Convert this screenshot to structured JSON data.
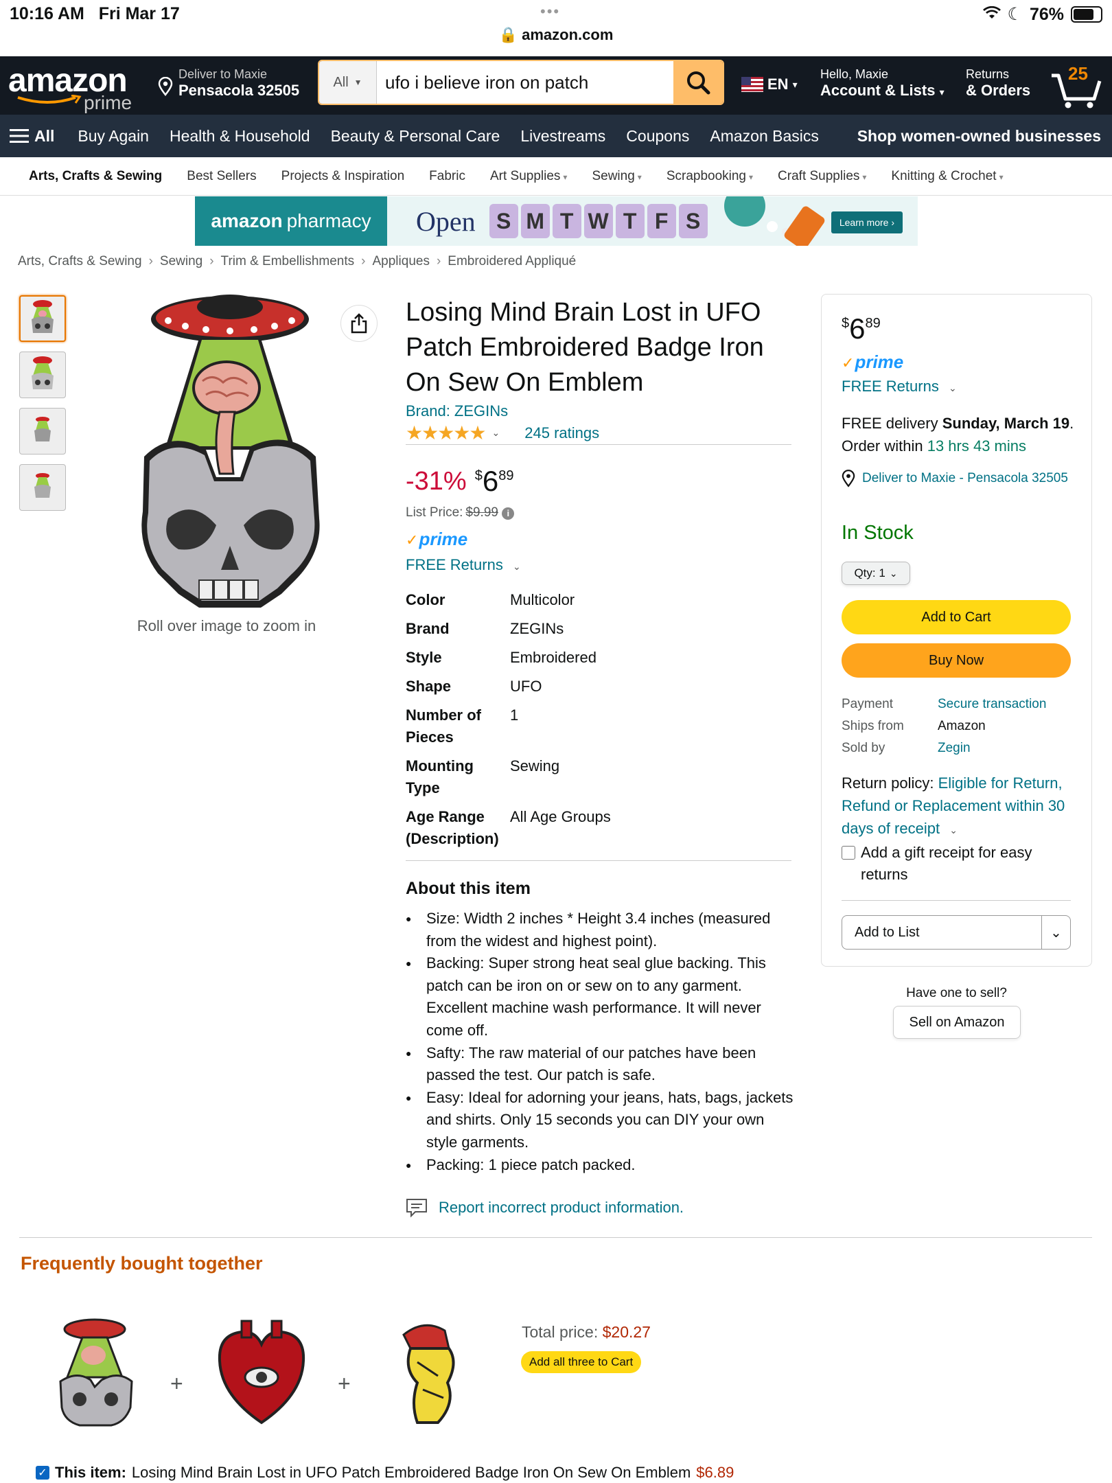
{
  "status": {
    "time": "10:16 AM",
    "date": "Fri Mar 17",
    "battery": "76%",
    "url": "amazon.com"
  },
  "header": {
    "logo": "amazon",
    "logo_sub": "prime",
    "deliver_line1": "Deliver to Maxie",
    "deliver_line2": "Pensacola 32505",
    "search_category": "All",
    "search_value": "ufo i believe iron on patch",
    "lang": "EN",
    "hello": "Hello, Maxie",
    "account": "Account & Lists",
    "returns": "Returns",
    "orders": "& Orders",
    "cart_count": "25"
  },
  "nav": {
    "all": "All",
    "items": [
      "Buy Again",
      "Health & Household",
      "Beauty & Personal Care",
      "Livestreams",
      "Coupons",
      "Amazon Basics"
    ],
    "promo": "Shop women-owned businesses"
  },
  "subnav": [
    "Arts, Crafts & Sewing",
    "Best Sellers",
    "Projects & Inspiration",
    "Fabric",
    "Art Supplies",
    "Sewing",
    "Scrapbooking",
    "Craft Supplies",
    "Knitting & Crochet"
  ],
  "banner": {
    "brand_a": "amazon",
    "brand_b": "pharmacy",
    "open": "Open",
    "days": [
      "S",
      "M",
      "T",
      "W",
      "T",
      "F",
      "S"
    ],
    "cta": "Learn more ›"
  },
  "breadcrumb": [
    "Arts, Crafts & Sewing",
    "Sewing",
    "Trim & Embellishments",
    "Appliques",
    "Embroidered Appliqué"
  ],
  "product": {
    "zoom_hint": "Roll over image to zoom in",
    "title": "Losing Mind Brain Lost in UFO Patch Embroidered Badge Iron On Sew On Emblem",
    "brand": "Brand: ZEGINs",
    "rating": 5,
    "ratings_count": "245 ratings",
    "discount": "-31%",
    "price_symbol": "$",
    "price_whole": "6",
    "price_cents": "89",
    "list_price_label": "List Price:",
    "list_price": "$9.99",
    "prime": "prime",
    "free_returns": "FREE Returns",
    "specs": [
      {
        "k": "Color",
        "v": "Multicolor"
      },
      {
        "k": "Brand",
        "v": "ZEGINs"
      },
      {
        "k": "Style",
        "v": "Embroidered"
      },
      {
        "k": "Shape",
        "v": "UFO"
      },
      {
        "k": "Number of Pieces",
        "v": "1"
      },
      {
        "k": "Mounting Type",
        "v": "Sewing"
      },
      {
        "k": "Age Range (Description)",
        "v": "All Age Groups"
      }
    ],
    "about_title": "About this item",
    "bullets": [
      "Size: Width 2 inches * Height 3.4 inches (measured from the widest and highest point).",
      "Backing: Super strong heat seal glue backing. This patch can be iron on or sew on to any garment. Excellent machine wash performance. It will never come off.",
      "Safty: The raw material of our patches have been passed the test. Our patch is safe.",
      "Easy: Ideal for adorning your jeans, hats, bags, jackets and shirts. Only 15 seconds you can DIY your own style garments.",
      "Packing: 1 piece patch packed."
    ],
    "report": "Report incorrect product information."
  },
  "buybox": {
    "price_symbol": "$",
    "price_whole": "6",
    "price_cents": "89",
    "prime": "prime",
    "free_returns": "FREE Returns",
    "delivery_a": "FREE delivery ",
    "delivery_date": "Sunday, March 19",
    "delivery_b": ". Order within ",
    "delivery_time": "13 hrs 43 mins",
    "deliver_to": "Deliver to Maxie - Pensacola 32505",
    "stock": "In Stock",
    "qty": "Qty: 1",
    "add_to_cart": "Add to Cart",
    "buy_now": "Buy Now",
    "payment_k": "Payment",
    "payment_v": "Secure transaction",
    "ships_k": "Ships from",
    "ships_v": "Amazon",
    "sold_k": "Sold by",
    "sold_v": "Zegin",
    "return_label": "Return policy: ",
    "return_link": "Eligible for Return, Refund or Replacement within 30 days of receipt",
    "gift": "Add a gift receipt for easy returns",
    "add_to_list": "Add to List",
    "sell_q": "Have one to sell?",
    "sell_btn": "Sell on Amazon"
  },
  "fbt": {
    "title": "Frequently bought together",
    "total_label": "Total price: ",
    "total": "$20.27",
    "add_all": "Add all three to Cart",
    "this_item_label": "This item:",
    "this_item_title": "Losing Mind Brain Lost in UFO Patch Embroidered Badge Iron On Sew On Emblem",
    "this_item_price": "$6.89"
  },
  "colors": {
    "accent": "#febd69",
    "nav": "#131921",
    "nav2": "#232f3e",
    "link": "#007185",
    "deal": "#cc0c39",
    "stock": "#007600"
  }
}
